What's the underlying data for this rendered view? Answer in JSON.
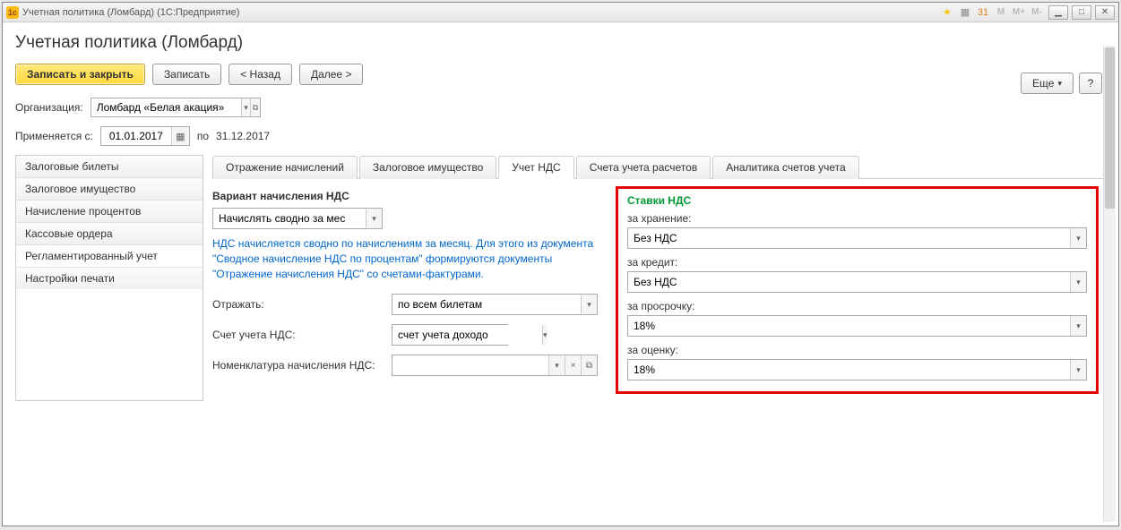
{
  "window": {
    "title": "Учетная политика (Ломбард)  (1С:Предприятие)",
    "app_icon": "1c"
  },
  "titlebar_icons": {
    "star": "★",
    "calc": "▦",
    "calendar": "31",
    "m": "M",
    "m_plus": "M+",
    "m_minus": "M-",
    "minimize": "▁",
    "maximize": "□",
    "close": "✕"
  },
  "page": {
    "title": "Учетная политика (Ломбард)"
  },
  "toolbar": {
    "save_close": "Записать и закрыть",
    "save": "Записать",
    "back": "< Назад",
    "forward": "Далее >",
    "more": "Еще",
    "help": "?"
  },
  "org": {
    "label": "Организация:",
    "value": "Ломбард «Белая акация»"
  },
  "period": {
    "from_label": "Применяется с:",
    "from_value": "01.01.2017",
    "to_label": "по",
    "to_value": "31.12.2017"
  },
  "sidebar": {
    "items": [
      "Залоговые билеты",
      "Залоговое имущество",
      "Начисление процентов",
      "Кассовые ордера",
      "Регламентированный учет",
      "Настройки печати"
    ]
  },
  "tabs": [
    "Отражение начислений",
    "Залоговое имущество",
    "Учет НДС",
    "Счета учета расчетов",
    "Аналитика счетов учета"
  ],
  "nds": {
    "variant_label": "Вариант начисления НДС",
    "variant_value": "Начислять сводно за мес",
    "info": "НДС начисляется сводно по начислениям за месяц. Для этого из документа \"Сводное начисление НДС по процентам\" формируются документы \"Отражение начисления НДС\" со счетами-фактурами.",
    "reflect_label": "Отражать:",
    "reflect_value": "по всем билетам",
    "account_label": "Счет учета НДС:",
    "account_value": "счет учета доходо",
    "nomen_label": "Номенклатура начисления НДС:",
    "nomen_value": ""
  },
  "rates": {
    "title": "Ставки НДС",
    "storage_label": "за хранение:",
    "storage_value": "Без НДС",
    "credit_label": "за кредит:",
    "credit_value": "Без НДС",
    "overdue_label": "за просрочку:",
    "overdue_value": "18%",
    "appraisal_label": "за оценку:",
    "appraisal_value": "18%"
  }
}
